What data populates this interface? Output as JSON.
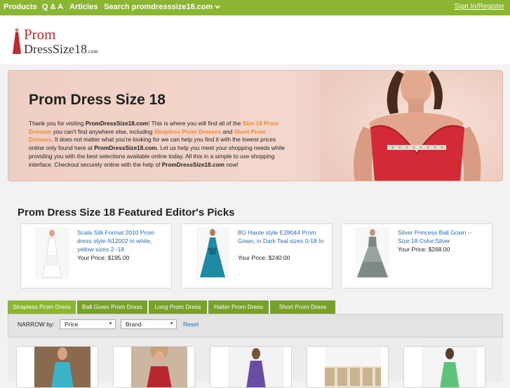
{
  "nav": {
    "items": [
      "Products",
      "Q & A",
      "Articles",
      "Search promdresssize18.com"
    ],
    "signin": "Sign In/Register"
  },
  "logo": {
    "line1": "Prom",
    "line2": "DressSize18",
    "suffix": ".com"
  },
  "hero": {
    "title": "Prom Dress Size 18",
    "p1": "Thank you for visiting ",
    "site1": "PromDressSize18.com",
    "p2": "! This is where you will find all of the ",
    "link1": "Size 18 Prom Dresses",
    "p3": " you can't find anywhere else, including ",
    "link2": "Strapless Prom Dresses",
    "p4": " and ",
    "link3": "Short Prom Dresses",
    "p5": ". It does not matter what you're looking for we can help you find it with the lowest prices online only found here at ",
    "site2": "PromDressSize18.com",
    "p6": ". Let us help you meet your shopping needs while providing you with the best selections available online today. All this in a simple to use shopping interface. Checkout securely online with the help of ",
    "site3": "PromDressSize18.com",
    "p7": " now!"
  },
  "featured": {
    "title": "Prom Dress Size 18 Featured Editor's Picks",
    "picks": [
      {
        "name": "Scala Silk Formal 2010 Prom dress style N12002 in white, yellow sizes 2 -18",
        "price": "Your Price: $195.00"
      },
      {
        "name": "BG Haute style E28044 Prom Gown, in Dark Teal sizes 0-18 In",
        "price": "Your Price: $240.00"
      },
      {
        "name": "Silver Princess Ball Gown -- Size:18 Color:Silver",
        "price": "Your Price: $268.00"
      }
    ]
  },
  "tabs": [
    "Strapless Prom Dress",
    "Ball Gown Prom Dress",
    "Long Prom Dress",
    "Halter Prom Dress",
    "Short Prom Dress"
  ],
  "filter": {
    "label": "NARROW by:",
    "price": "Price",
    "brand": "Brand",
    "reset": "Reset"
  },
  "colors": {
    "nav_green": "#8cb531",
    "tab_green": "#78a12a",
    "link_blue": "#2a6cbf",
    "highlight_orange": "#f0893a",
    "logo_red": "#c0282d"
  }
}
